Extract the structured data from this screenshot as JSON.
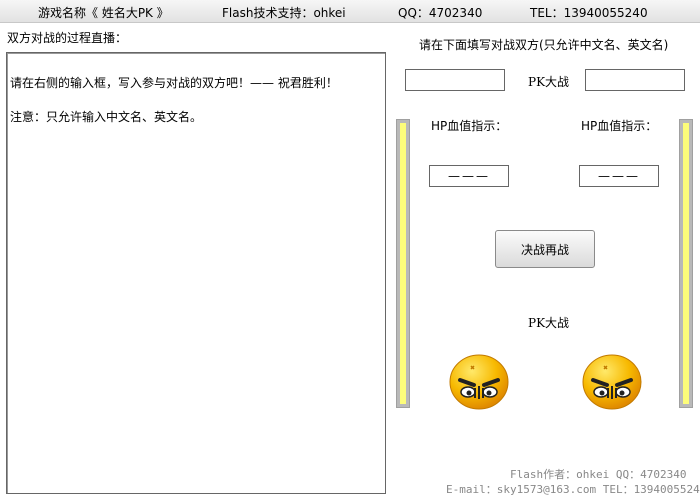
{
  "header": {
    "game_name": "游戏名称《 姓名大PK 》",
    "flash_support": "Flash技术支持：ohkei",
    "qq": "QQ：4702340",
    "tel": "TEL：13940055240"
  },
  "log": {
    "title": "双方对战的过程直播：",
    "lines": [
      "请在右侧的输入框，写入参与对战的双方吧！—— 祝君胜利！",
      "注意：只允许输入中文名、英文名。"
    ]
  },
  "battle": {
    "instruction": "请在下面填写对战双方(只允许中文名、英文名)",
    "left_name": "",
    "right_name": "",
    "pk_label_top": "PK大战",
    "hp_label_left": "HP血值指示：",
    "hp_label_right": "HP血值指示：",
    "hp_value_left": "———",
    "hp_value_right": "———",
    "fight_button": "决战再战",
    "pk_label_bottom": "PK大战",
    "hp_fill_left": 1.0,
    "hp_fill_right": 1.0
  },
  "footer": {
    "line1": "Flash作者：ohkei   QQ：4702340",
    "line2": "E-mail：sky1573@163.com  TEL：13940055240"
  },
  "colors": {
    "hp_fill": "#fdfd7a",
    "hp_track": "#b9b9b9",
    "face": "#f7b900"
  },
  "icons": {
    "left_fighter": "angry-face-icon",
    "right_fighter": "angry-face-icon"
  }
}
